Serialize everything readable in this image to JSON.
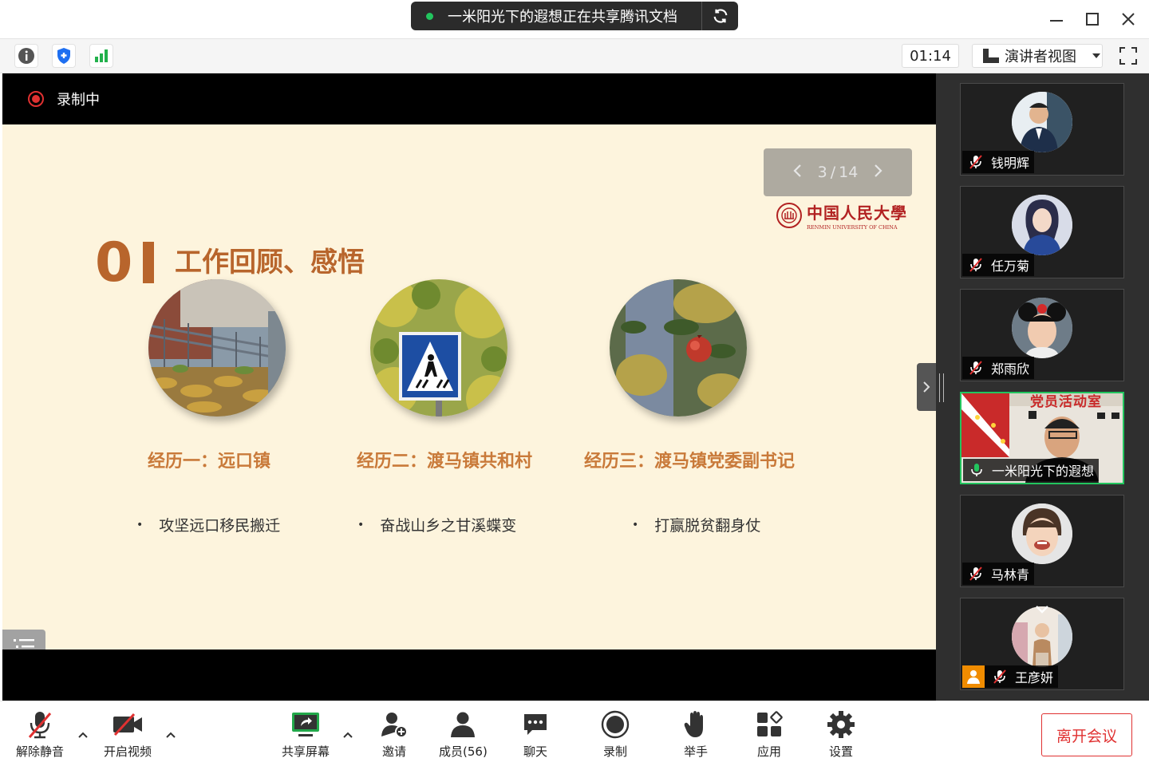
{
  "titlebar": {
    "share_banner": "一米阳光下的遐想正在共享腾讯文档",
    "status_color": "#22c55e"
  },
  "toolbar": {
    "timer": "01:14",
    "view_mode": "演讲者视图",
    "icons": [
      "info-icon",
      "shield-icon",
      "signal-icon"
    ]
  },
  "recording": {
    "label": "录制中",
    "color": "#e03131"
  },
  "slide": {
    "pager": {
      "current": "3",
      "total": "14"
    },
    "university": {
      "name_cn": "中国人民大學",
      "name_en": "RENMIN UNIVERSITY OF CHINA"
    },
    "section_number": "0",
    "section_title": "工作回顾、感悟",
    "accent_color": "#b8652c",
    "experiences": [
      {
        "title": "经历一：远口镇",
        "bullet": "攻坚远口移民搬迁"
      },
      {
        "title": "经历二：渡马镇共和村",
        "bullet": "奋战山乡之甘溪蝶变"
      },
      {
        "title": "经历三：渡马镇党委副书记",
        "bullet": "打赢脱贫翻身仗"
      }
    ]
  },
  "gallery": {
    "participants": [
      {
        "name": "钱明辉",
        "muted": true
      },
      {
        "name": "任万菊",
        "muted": true
      },
      {
        "name": "郑雨欣",
        "muted": true
      },
      {
        "name": "一米阳光下的遐想",
        "muted": false,
        "speaking": true,
        "banner_text": "党员活动室"
      },
      {
        "name": "马林青",
        "muted": true
      },
      {
        "name": "王彦妍",
        "muted": true
      }
    ]
  },
  "bottombar": {
    "unmute": "解除静音",
    "video": "开启视频",
    "share": "共享屏幕",
    "invite": "邀请",
    "members": "成员(56)",
    "chat": "聊天",
    "record": "录制",
    "raise_hand": "举手",
    "apps": "应用",
    "settings": "设置",
    "leave": "离开会议"
  }
}
